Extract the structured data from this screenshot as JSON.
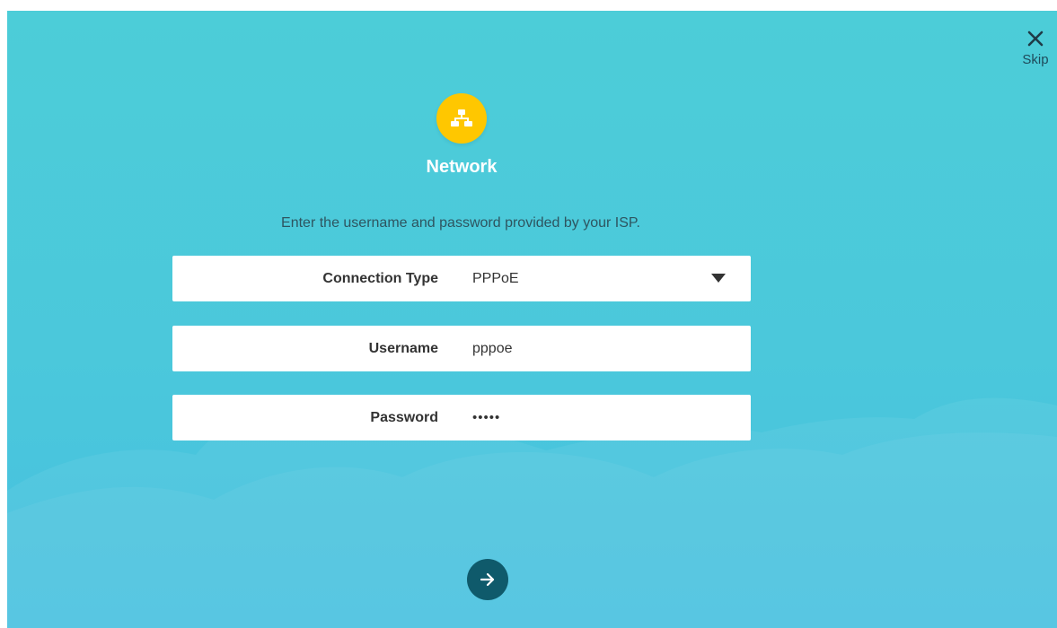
{
  "header": {
    "skip_label": "Skip"
  },
  "step": {
    "title": "Network",
    "icon": "network-topology-icon",
    "instruction": "Enter the username and password provided by your ISP."
  },
  "form": {
    "connection_type": {
      "label": "Connection Type",
      "value": "PPPoE"
    },
    "username": {
      "label": "Username",
      "value": "pppoe"
    },
    "password": {
      "label": "Password",
      "value": "•••••"
    }
  },
  "colors": {
    "background": "#4bc8db",
    "icon_circle": "#ffc700",
    "next_button": "#0f5a6b",
    "field_background": "#ffffff"
  }
}
